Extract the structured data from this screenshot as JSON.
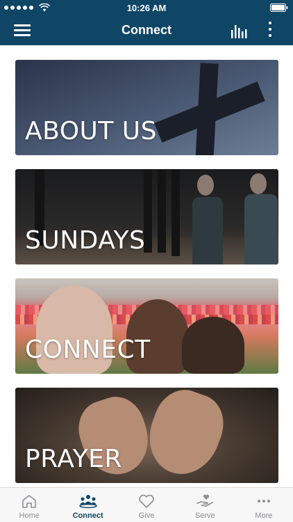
{
  "status_bar": {
    "time": "10:26 AM"
  },
  "nav": {
    "title": "Connect"
  },
  "cards": [
    {
      "label": "ABOUT US"
    },
    {
      "label": "SUNDAYS"
    },
    {
      "label": "CONNECT"
    },
    {
      "label": "PRAYER"
    }
  ],
  "tabs": [
    {
      "label": "Home",
      "icon": "home-icon"
    },
    {
      "label": "Connect",
      "icon": "people-icon"
    },
    {
      "label": "Give",
      "icon": "heart-icon"
    },
    {
      "label": "Serve",
      "icon": "hand-heart-icon"
    },
    {
      "label": "More",
      "icon": "more-horizontal-icon"
    }
  ],
  "active_tab": "Connect",
  "colors": {
    "brand": "#0f4565",
    "tab_inactive": "#8e8e93",
    "background": "#ffffff"
  }
}
